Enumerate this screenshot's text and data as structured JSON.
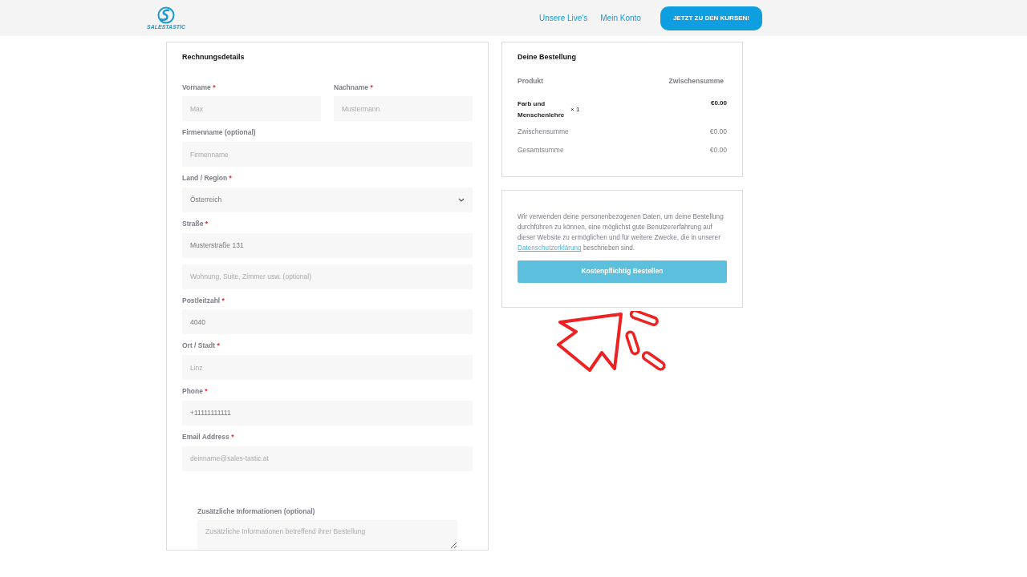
{
  "header": {
    "logo": "SALESTASTIC",
    "nav": [
      {
        "label": "Unsere Live's"
      },
      {
        "label": "Mein Konto"
      }
    ],
    "cta": "JETZT ZU DEN KURSEN!"
  },
  "billing": {
    "title": "Rechnungsdetails",
    "rows": [
      {
        "fields": [
          {
            "kind": "text",
            "label": "Vorname",
            "required_mark": "*",
            "placeholder": "Max"
          },
          {
            "kind": "text",
            "label": "Nachname",
            "required_mark": "*",
            "placeholder": "Mustermann"
          }
        ]
      },
      {
        "fields": [
          {
            "kind": "text",
            "label": "Firmenname (optional)",
            "placeholder": "Firmenname"
          }
        ]
      },
      {
        "fields": [
          {
            "kind": "select",
            "label": "Land / Region",
            "required_mark": "*",
            "value": "Österreich"
          }
        ]
      },
      {
        "fields": [
          {
            "kind": "text",
            "label": "Straße",
            "required_mark": "*",
            "value": "Musterstraße 131"
          }
        ]
      },
      {
        "fields": [
          {
            "kind": "text",
            "placeholder": "Wohnung, Suite, Zimmer usw. (optional)"
          }
        ]
      },
      {
        "fields": [
          {
            "kind": "text",
            "label": "Postleitzahl",
            "required_mark": "*",
            "value": "4040"
          }
        ]
      },
      {
        "fields": [
          {
            "kind": "text",
            "label": "Ort / Stadt",
            "required_mark": "*",
            "placeholder": "Linz"
          }
        ]
      },
      {
        "fields": [
          {
            "kind": "text",
            "label": "Phone",
            "required_mark": "*",
            "value": "+11111111111"
          }
        ]
      },
      {
        "fields": [
          {
            "kind": "text",
            "label": "Email Address",
            "required_mark": "*",
            "placeholder": "deinname@sales-tastic.at"
          }
        ]
      }
    ],
    "additional": {
      "kind": "textarea",
      "label": "Zusätzliche Informationen (optional)",
      "placeholder": "Zusätzliche Informationen betreffend ihrer Bestellung"
    }
  },
  "order": {
    "title": "Deine Bestellung",
    "columns": [
      "Produkt",
      "Zwischensumme"
    ],
    "items": [
      {
        "name": "Farb und Menschenlehre",
        "qty": "× 1",
        "total": "€0.00"
      }
    ],
    "totals": [
      {
        "label": "Zwischensumme",
        "value": "€0.00"
      },
      {
        "label": "Gesamtsumme",
        "value": "€0.00"
      }
    ]
  },
  "privacy": {
    "before": "Wir verwenden deine personenbezogenen Daten, um deine Bestellung durchführen zu können, eine möglichst gute Benutzererfahrung auf dieser Website zu ermöglichen und für weitere Zwecke, die in unserer ",
    "link": "Datenschutzerklärung",
    "after": " beschrieben sind.",
    "button": "Kostenpflichtig Bestellen"
  }
}
